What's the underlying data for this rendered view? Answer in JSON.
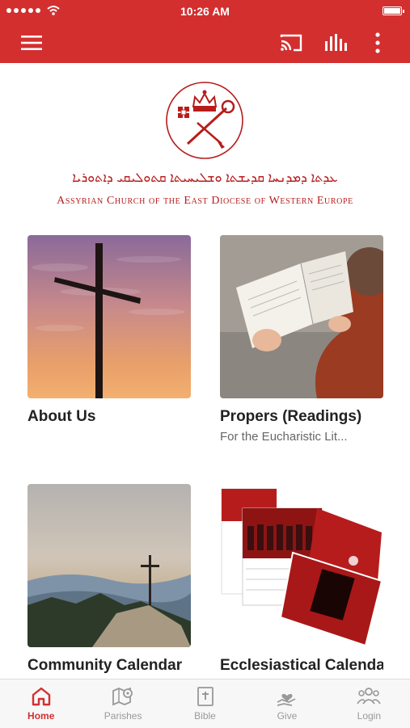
{
  "status_bar": {
    "time": "10:26 AM"
  },
  "app_bar": {
    "menu_icon": "hamburger-menu-icon",
    "cast_icon": "cast-icon",
    "audio_icon": "audio-bars-icon",
    "more_icon": "more-vertical-icon"
  },
  "header": {
    "syriac_title": "ܥܕܬܐ ܕܡܕܢܚܐ ܩܕܝܫܬܐ ܘܫܠܝܚܝܬܐ ܩܬܘܠܝܩܝ ܕܐܬܘܪܝܐ",
    "diocese_title": "Assyrian Church of the East Diocese of Western Europe"
  },
  "tiles": [
    {
      "title": "About Us",
      "subtitle": ""
    },
    {
      "title": "Propers (Readings)",
      "subtitle": "For the Eucharistic Lit..."
    },
    {
      "title": "Community Calendar",
      "subtitle": ""
    },
    {
      "title": "Ecclesiastical Calendar",
      "subtitle": ""
    }
  ],
  "bottom_nav": [
    {
      "label": "Home",
      "icon": "home-icon",
      "active": true
    },
    {
      "label": "Parishes",
      "icon": "map-pin-icon",
      "active": false
    },
    {
      "label": "Bible",
      "icon": "bible-icon",
      "active": false
    },
    {
      "label": "Give",
      "icon": "give-heart-icon",
      "active": false
    },
    {
      "label": "Login",
      "icon": "people-icon",
      "active": false
    }
  ],
  "colors": {
    "accent": "#d32f2f",
    "accent_dark": "#b71c1c",
    "inactive": "#999999"
  }
}
